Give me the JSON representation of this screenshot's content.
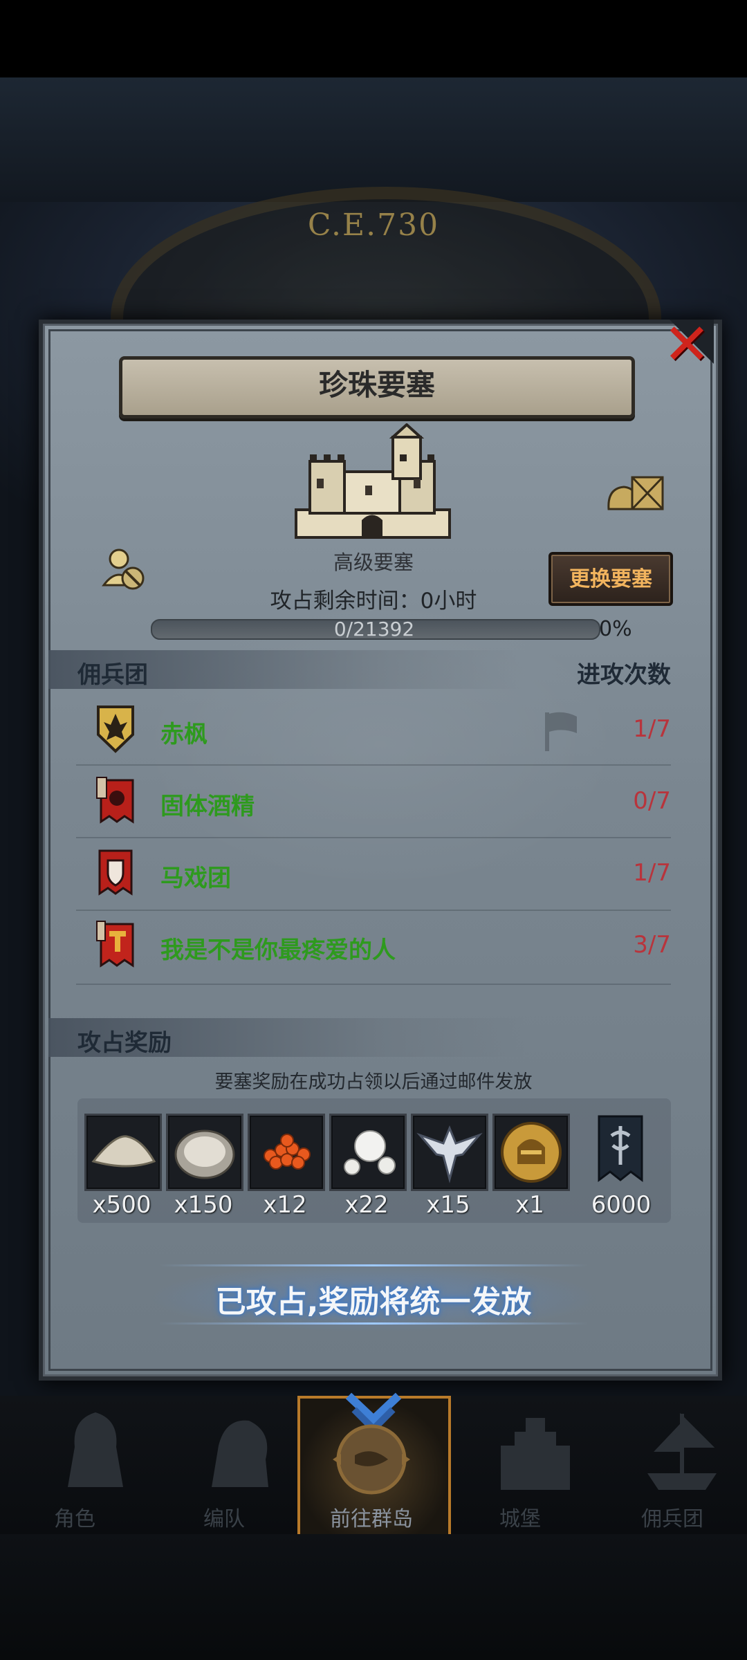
{
  "background": {
    "era_label": "C.E.730"
  },
  "dialog": {
    "title": "珍珠要塞",
    "fortress_type": "高级要塞",
    "change_button": "更换要塞",
    "time_remaining": "攻占剩余时间：0小时",
    "progress": {
      "label": "0/21392",
      "percent_text": "0%",
      "fraction": 0.0
    },
    "mercenary_section": {
      "title": "佣兵团",
      "attacks_header": "进攻次数",
      "guilds": [
        {
          "name": "赤枫",
          "attacks": "1/7",
          "emblem": "maple-shield-icon"
        },
        {
          "name": "固体酒精",
          "attacks": "0/7",
          "emblem": "red-banner-icon"
        },
        {
          "name": "马戏团",
          "attacks": "1/7",
          "emblem": "shield-banner-icon"
        },
        {
          "name": "我是不是你最疼爱的人",
          "attacks": "3/7",
          "emblem": "red-t-banner-icon"
        }
      ]
    },
    "reward_section": {
      "title": "攻占奖励",
      "note": "要塞奖励在成功占领以后通过邮件发放",
      "items": [
        {
          "icon": "pile-icon",
          "qty": "x500"
        },
        {
          "icon": "oyster-icon",
          "qty": "x150"
        },
        {
          "icon": "roe-icon",
          "qty": "x12"
        },
        {
          "icon": "pearl-icon",
          "qty": "x22"
        },
        {
          "icon": "winged-crest-icon",
          "qty": "x15"
        },
        {
          "icon": "helmet-coin-icon",
          "qty": "x1"
        },
        {
          "icon": "guild-banner-icon",
          "qty": "6000"
        }
      ]
    },
    "captured_text": "已攻占,奖励将统一发放"
  },
  "navbar": {
    "items": [
      {
        "label": "角色",
        "icon": "knight-icon"
      },
      {
        "label": "编队",
        "icon": "formation-icon"
      },
      {
        "label": "前往群岛",
        "icon": "compass-map-icon"
      },
      {
        "label": "城堡",
        "icon": "castle-icon"
      },
      {
        "label": "佣兵团",
        "icon": "ship-icon"
      }
    ]
  },
  "colors": {
    "guild_name": "#2e9a1e",
    "attack_count": "#b8343c",
    "change_button_text": "#f2b45e",
    "close_x": "#d0241c",
    "active_nav_border": "#b87a2a"
  }
}
